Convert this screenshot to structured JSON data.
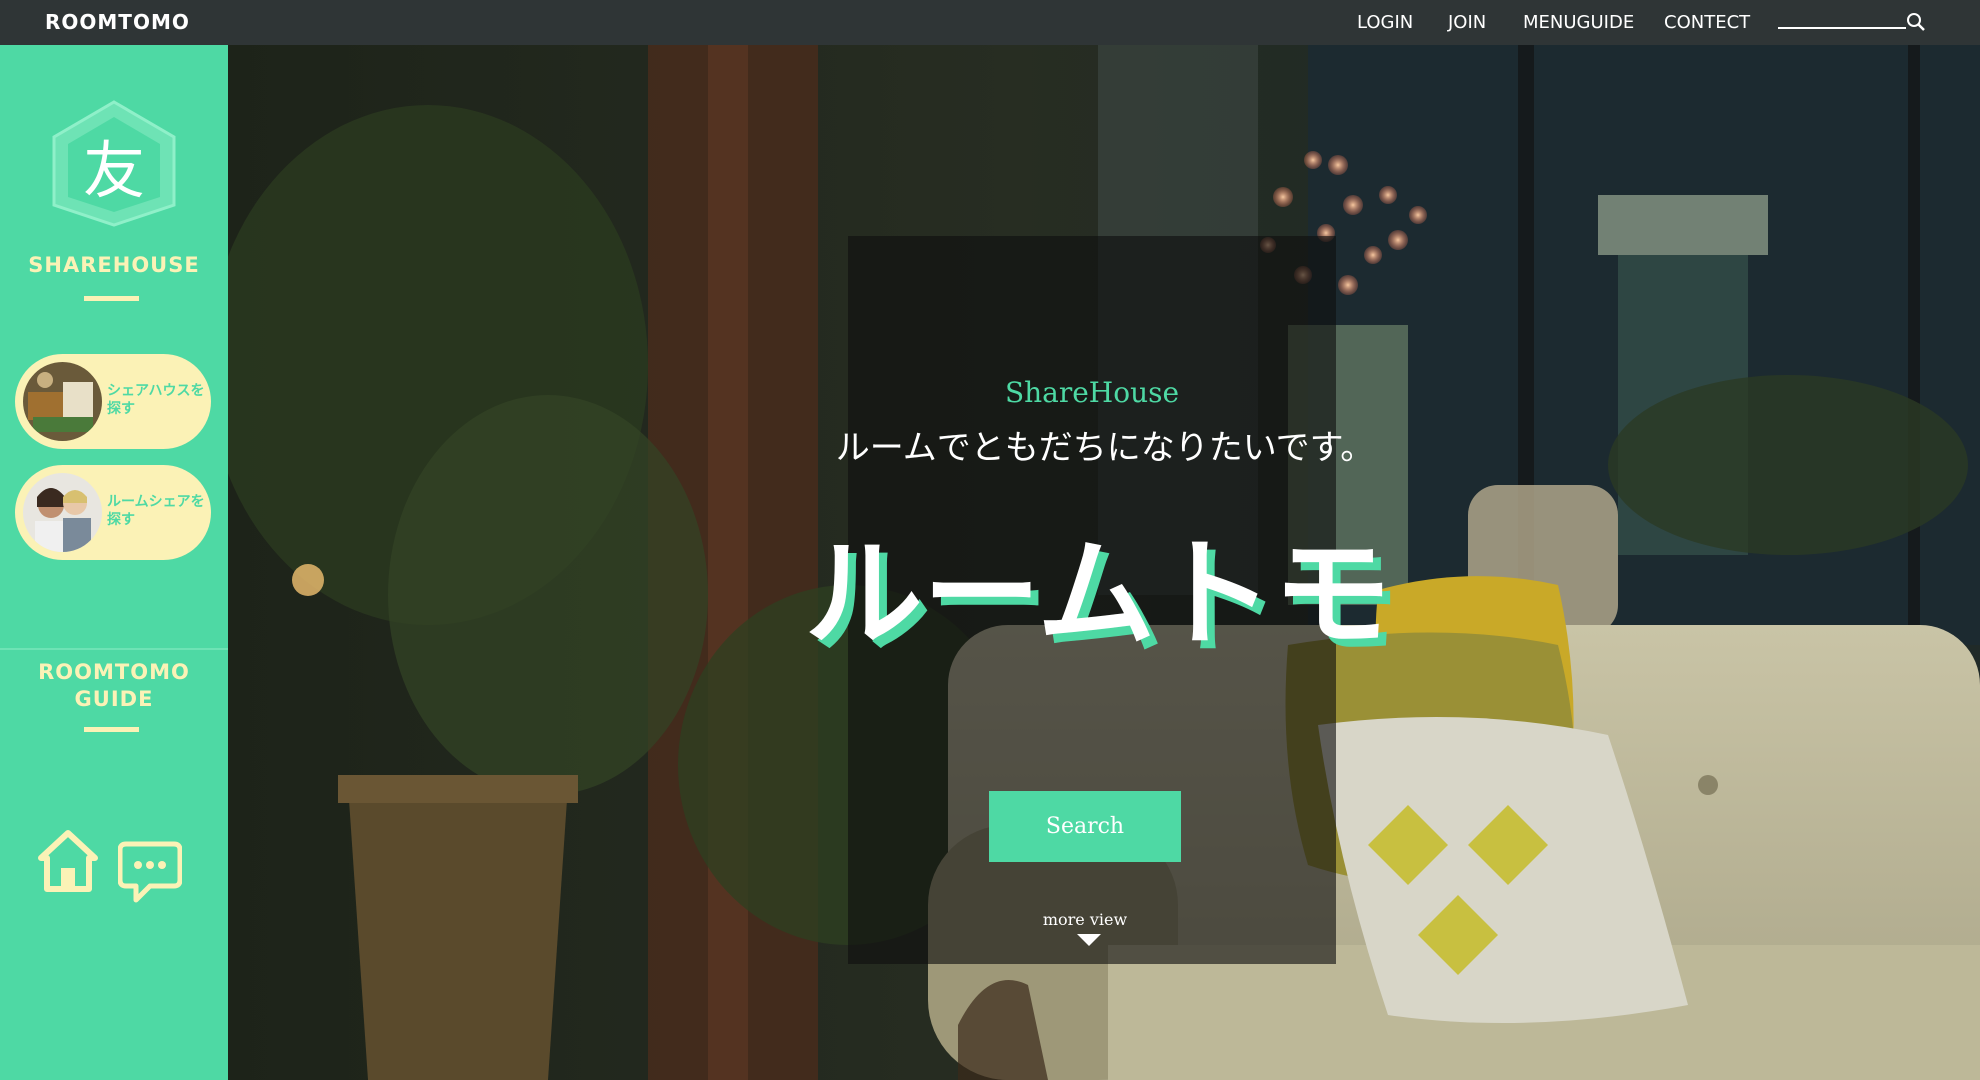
{
  "topbar": {
    "brand": "ROOMTOMO",
    "nav": [
      "LOGIN",
      "JOIN",
      "MENUGUIDE",
      "CONTECT"
    ]
  },
  "sidebar": {
    "logo_char": "友",
    "section_title": "SHAREHOUSE",
    "pills": [
      {
        "label": "シェアハウスを探す"
      },
      {
        "label": "ルームシェアを探す"
      }
    ],
    "guide_title_line1": "ROOMTOMO",
    "guide_title_line2": "GUIDE",
    "icons": [
      "home-icon",
      "chat-icon"
    ]
  },
  "hero": {
    "subtitle": "ShareHouse",
    "tagline": "ルームでともだちになりたいです。",
    "big_title": "ルームトモ",
    "search_button": "Search",
    "more_view": "more view"
  },
  "colors": {
    "accent": "#4ed9a4",
    "cream": "#fbf2b6",
    "topbar": "#2f3536"
  }
}
